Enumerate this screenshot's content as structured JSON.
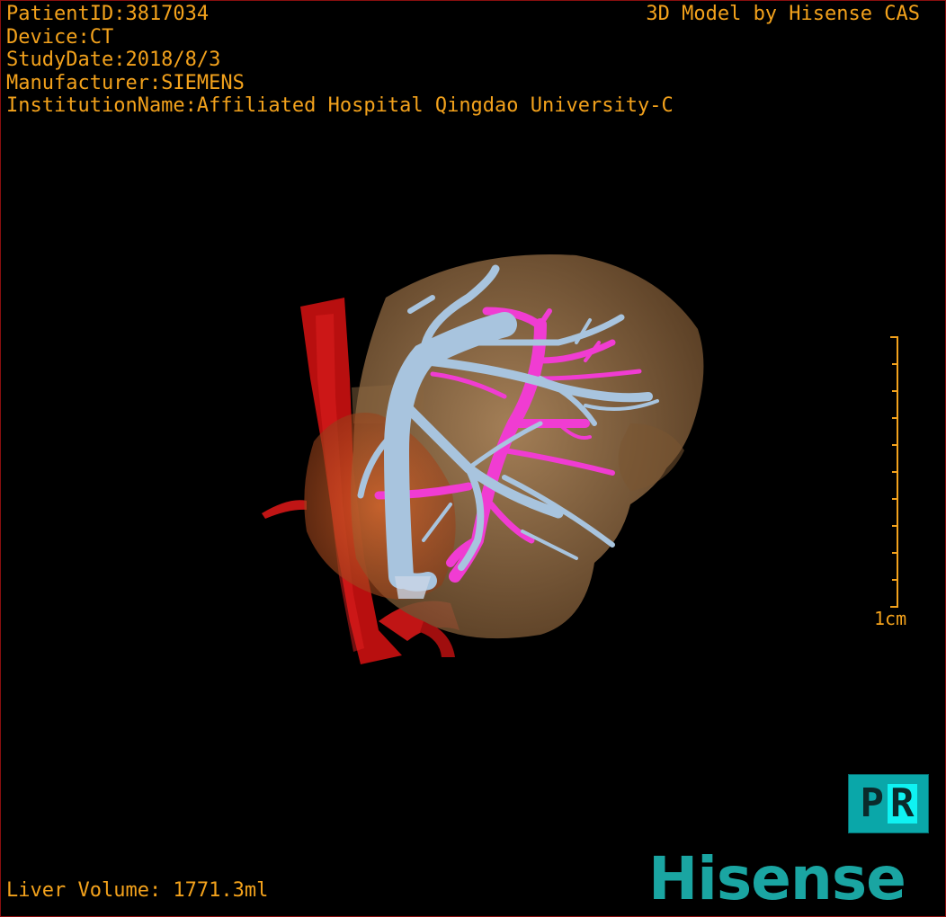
{
  "header": {
    "patient_id": "PatientID:3817034",
    "device": "Device:CT",
    "study_date": "StudyDate:2018/8/3",
    "manufacturer": "Manufacturer:SIEMENS",
    "institution": "InstitutionName:Affiliated Hospital Qingdao University-C"
  },
  "credit": "3D Model by Hisense CAS",
  "scale_bar": {
    "label": "1cm"
  },
  "footer": {
    "volume": "Liver Volume: 1771.3ml",
    "brand": "Hisense"
  },
  "view_mode": {
    "p": "P",
    "r": "R"
  },
  "colors": {
    "text": "#f3a21c",
    "liver": "#a98256",
    "portal_vein": "#a8c4de",
    "hepatic_vein": "#f03cd2",
    "aorta": "#c01010",
    "brand": "#1aa5a2"
  }
}
